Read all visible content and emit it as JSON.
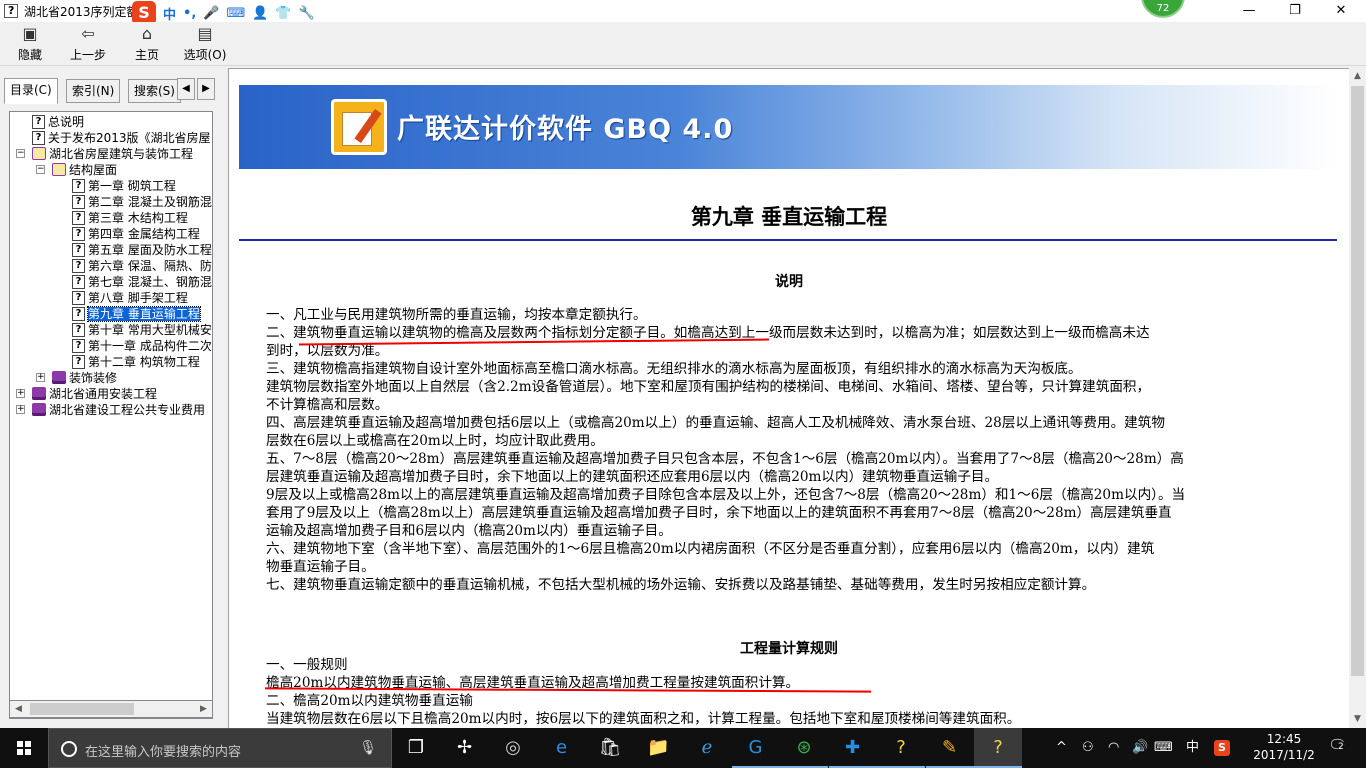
{
  "window": {
    "title": "湖北省2013序列定额",
    "badge": "72",
    "controls": {
      "minimize": "—",
      "restore": "❐",
      "close": "✕"
    }
  },
  "ime": {
    "logo": "S",
    "mode": "中",
    "items": [
      "•,",
      "🎤",
      "⌨",
      "👤",
      "👕",
      "🔧"
    ]
  },
  "toolbar": [
    {
      "label": "隐藏",
      "icon": "hide-icon"
    },
    {
      "label": "上一步",
      "icon": "back-arrow-icon"
    },
    {
      "label": "主页",
      "icon": "home-icon"
    },
    {
      "label": "选项(O)",
      "icon": "options-icon"
    }
  ],
  "nav": {
    "tabs": [
      "目录(C)",
      "索引(N)",
      "搜索(S)"
    ],
    "tab_arrows": [
      "◀",
      "▶"
    ],
    "tree": [
      {
        "level": 1,
        "type": "page",
        "label": "总说明"
      },
      {
        "level": 1,
        "type": "page",
        "label": "关于发布2013版《湖北省房屋"
      },
      {
        "level": 0,
        "type": "book-open",
        "exp": "−",
        "label": "湖北省房屋建筑与装饰工程"
      },
      {
        "level": 1,
        "type": "book-open",
        "exp": "−",
        "label": "结构屋面"
      },
      {
        "level": 2,
        "type": "page",
        "label": "第一章 砌筑工程"
      },
      {
        "level": 2,
        "type": "page",
        "label": "第二章 混凝土及钢筋混"
      },
      {
        "level": 2,
        "type": "page",
        "label": "第三章 木结构工程"
      },
      {
        "level": 2,
        "type": "page",
        "label": "第四章 金属结构工程"
      },
      {
        "level": 2,
        "type": "page",
        "label": "第五章 屋面及防水工程"
      },
      {
        "level": 2,
        "type": "page",
        "label": "第六章 保温、隔热、防"
      },
      {
        "level": 2,
        "type": "page",
        "label": "第七章 混凝土、钢筋混"
      },
      {
        "level": 2,
        "type": "page",
        "label": "第八章 脚手架工程"
      },
      {
        "level": 2,
        "type": "page",
        "label": "第九章 垂直运输工程",
        "selected": true
      },
      {
        "level": 2,
        "type": "page",
        "label": "第十章 常用大型机械安"
      },
      {
        "level": 2,
        "type": "page",
        "label": "第十一章 成品构件二次"
      },
      {
        "level": 2,
        "type": "page",
        "label": "第十二章 构筑物工程"
      },
      {
        "level": 1,
        "type": "book",
        "exp": "+",
        "label": "装饰装修"
      },
      {
        "level": 0,
        "type": "book",
        "exp": "+",
        "label": "湖北省通用安装工程"
      },
      {
        "level": 0,
        "type": "book",
        "exp": "+",
        "label": "湖北省建设工程公共专业费用"
      }
    ]
  },
  "content": {
    "banner": "广联达计价软件 GBQ 4.0",
    "chapter_title": "第九章  垂直运输工程",
    "section1_title": "说明",
    "section1_paragraphs": [
      "一、凡工业与民用建筑物所需的垂直运输，均按本章定额执行。",
      "二、建筑物垂直运输以建筑物的檐高及层数两个指标划分定额子目。如檐高达到上一级而层数未达到时，以檐高为准；如层数达到上一级而檐高未达\n到时，以层数为准。",
      "三、建筑物檐高指建筑物自设计室外地面标高至檐口滴水标高。无组织排水的滴水标高为屋面板顶，有组织排水的滴水标高为天沟板底。\n建筑物层数指室外地面以上自然层（含2.2m设备管道层）。地下室和屋顶有围护结构的楼梯间、电梯间、水箱间、塔楼、望台等，只计算建筑面积，\n不计算檐高和层数。",
      "四、高层建筑垂直运输及超高增加费包括6层以上（或檐高20m以上）的垂直运输、超高人工及机械降效、清水泵台班、28层以上通讯等费用。建筑物\n层数在6层以上或檐高在20m以上时，均应计取此费用。",
      "五、7～8层（檐高20～28m）高层建筑垂直运输及超高增加费子目只包含本层，不包含1～6层（檐高20m以内）。当套用了7～8层（檐高20～28m）高\n层建筑垂直运输及超高增加费子目时，余下地面以上的建筑面积还应套用6层以内（檐高20m以内）建筑物垂直运输子目。\n9层及以上或檐高28m以上的高层建筑垂直运输及超高增加费子目除包含本层及以上外，还包含7～8层（檐高20～28m）和1～6层（檐高20m以内）。当\n套用了9层及以上（檐高28m以上）高层建筑垂直运输及超高增加费子目时，余下地面以上的建筑面积不再套用7～8层（檐高20～28m）高层建筑垂直\n运输及超高增加费子目和6层以内（檐高20m以内）垂直运输子目。",
      "六、建筑物地下室（含半地下室）、高层范围外的1～6层且檐高20m以内裙房面积（不区分是否垂直分割），应套用6层以内（檐高20m，以内）建筑\n物垂直运输子目。",
      "七、建筑物垂直运输定额中的垂直运输机械，不包括大型机械的场外运输、安拆费以及路基铺垫、基础等费用，发生时另按相应定额计算。"
    ],
    "section2_title": "工程量计算规则",
    "section2_paragraphs": [
      "一、一般规则\n檐高20m以内建筑物垂直运输、高层建筑垂直运输及超高增加费工程量按建筑面积计算。\n二、檐高20m以内建筑物垂直运输\n当建筑物层数在6层以下且檐高20m以内时，按6层以下的建筑面积之和，计算工程量。包括地下室和屋顶楼梯间等建筑面积。"
    ]
  },
  "taskbar": {
    "search_placeholder": "在这里输入你要搜索的内容",
    "apps": [
      "task-view-icon",
      "fan-icon",
      "spiral-app-icon",
      "edge-icon",
      "store-icon",
      "folder-icon",
      "ie-icon",
      "glodon-icon",
      "green-app-icon",
      "plus-app-icon",
      "help-icon",
      "notes-icon",
      "help-active-icon"
    ],
    "tray": {
      "ime": "中",
      "sogou": "S"
    },
    "time": "12:45",
    "date": "2017/11/2",
    "notifications": "2"
  }
}
